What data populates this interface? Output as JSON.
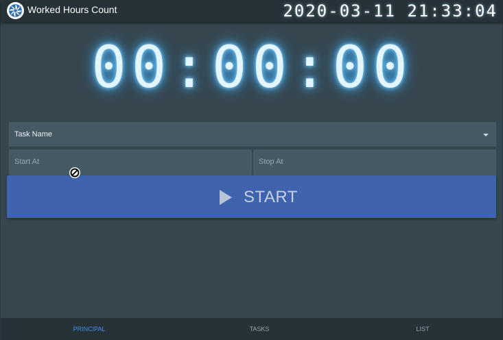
{
  "app": {
    "title": "Worked Hours Count",
    "datetime": "2020-03-11 21:33:04"
  },
  "timer": {
    "display": "00:00:00"
  },
  "form": {
    "task_name_label": "Task Name",
    "start_at_label": "Start At",
    "stop_at_label": "Stop At"
  },
  "start_button": {
    "label": "START"
  },
  "bottom_nav": {
    "items": [
      {
        "label": "PRINCIPAL",
        "active": true
      },
      {
        "label": "TASKS",
        "active": false
      },
      {
        "label": "LIST",
        "active": false
      }
    ]
  },
  "colors": {
    "background": "#37474f",
    "topbar": "#263238",
    "primary_button": "#3f63ac",
    "active_nav": "#4a8ee8",
    "timer_glow": "#8fd9ff"
  },
  "icons": [
    "app-logo-icon",
    "dropdown-arrow-icon",
    "play-icon",
    "not-allowed-cursor-icon"
  ]
}
